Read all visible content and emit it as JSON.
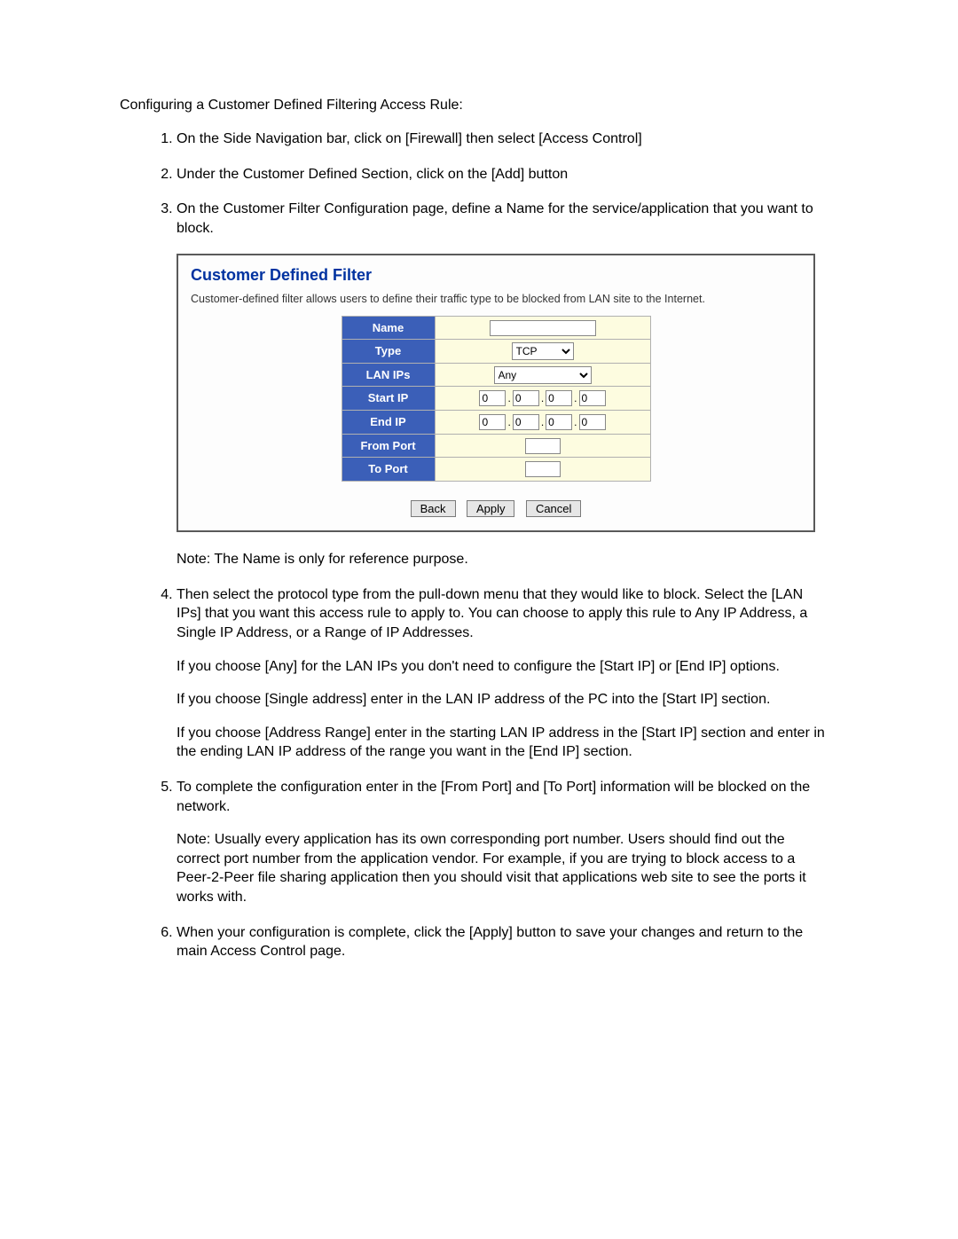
{
  "intro": "Configuring a Customer Defined Filtering Access Rule:",
  "steps": {
    "s1": "On the Side Navigation bar, click on [Firewall] then select [Access Control]",
    "s2": "Under the Customer Defined Section, click on the [Add] button",
    "s3": "On the Customer Filter Configuration page, define a Name for the service/application that you want to block.",
    "s3_note": "Note: The Name is only for reference purpose.",
    "s4": "Then select the protocol type from the pull-down menu that they would like to block. Select the [LAN IPs] that you want this access rule to apply to. You can choose to apply this rule to Any IP Address, a Single IP Address, or a Range of IP Addresses.",
    "s4_p1": "If you choose [Any] for the LAN IPs you don't need to configure the [Start IP] or [End IP] options.",
    "s4_p2": "If you choose [Single address] enter in the LAN IP address of the PC into the [Start IP] section.",
    "s4_p3": "If you choose [Address Range] enter in the starting LAN IP address in the [Start IP] section and enter in the ending LAN IP address of the range you want in the [End IP] section.",
    "s5": "To complete the configuration enter in the [From Port] and [To Port] information will be blocked on the network.",
    "s5_note": "Note: Usually every application has its own corresponding port number. Users should find out the correct port number from the application vendor. For example, if you are trying to block access to a Peer-2-Peer file sharing application then you should visit that applications web site to see the ports it works with.",
    "s6": "When your configuration is complete, click the [Apply] button to save your changes and return to the main Access Control page."
  },
  "panel": {
    "title": "Customer Defined Filter",
    "desc": "Customer-defined filter allows users to define their traffic type to be blocked from LAN site to the Internet.",
    "labels": {
      "name": "Name",
      "type": "Type",
      "lanips": "LAN IPs",
      "startip": "Start IP",
      "endip": "End IP",
      "fromport": "From Port",
      "toport": "To Port"
    },
    "values": {
      "type_selected": "TCP",
      "lan_selected": "Any",
      "ip_seg": "0"
    },
    "buttons": {
      "back": "Back",
      "apply": "Apply",
      "cancel": "Cancel"
    }
  }
}
